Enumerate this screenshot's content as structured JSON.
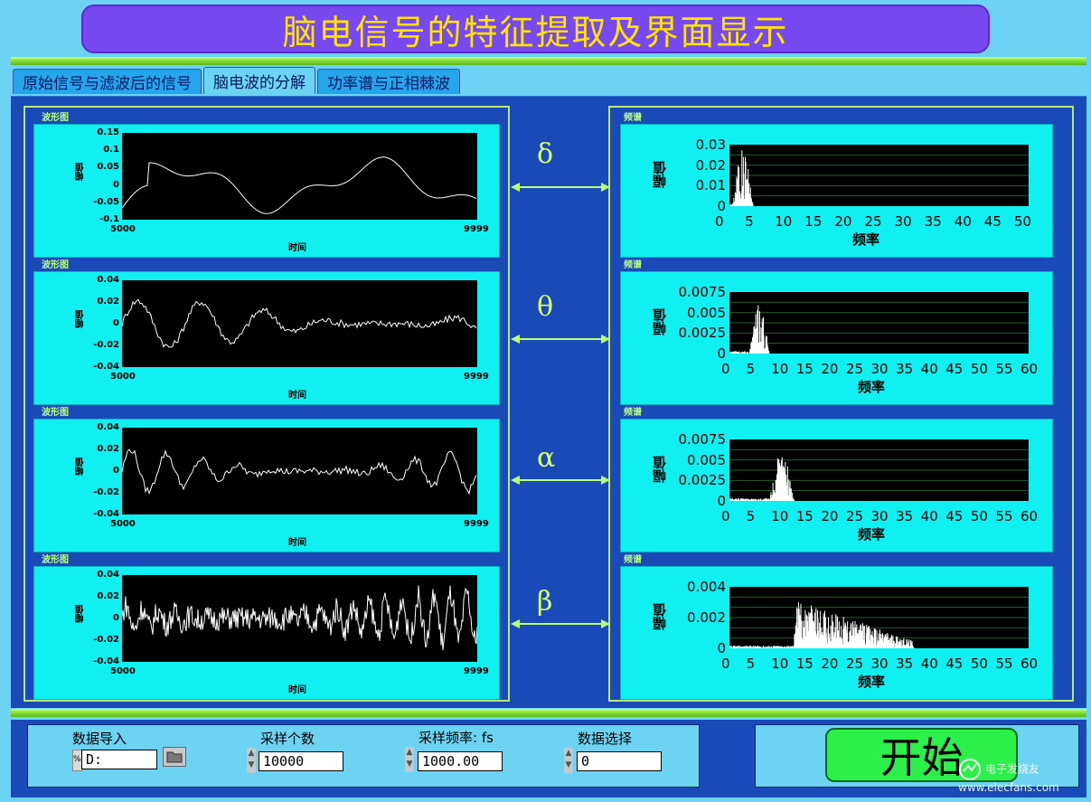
{
  "title": "脑电信号的特征提取及界面显示",
  "tabs": [
    {
      "label": "原始信号与滤波后的信号",
      "active": false
    },
    {
      "label": "脑电波的分解",
      "active": true
    },
    {
      "label": "功率谱与正相棘波",
      "active": false
    }
  ],
  "waveforms": [
    {
      "label": "波形图",
      "ylabel": "幅值",
      "xlabel": "时间",
      "yticks": [
        "0.15",
        "0.1",
        "0.05",
        "0",
        "-0.05",
        "-0.1"
      ],
      "xticks": [
        "5000",
        "9999"
      ]
    },
    {
      "label": "波形图",
      "ylabel": "幅值",
      "xlabel": "时间",
      "yticks": [
        "0.04",
        "0.02",
        "0",
        "-0.02",
        "-0.04"
      ],
      "xticks": [
        "5000",
        "9999"
      ]
    },
    {
      "label": "波形图",
      "ylabel": "幅值",
      "xlabel": "时间",
      "yticks": [
        "0.04",
        "0.02",
        "0",
        "-0.02",
        "-0.04"
      ],
      "xticks": [
        "5000",
        "9999"
      ]
    },
    {
      "label": "波形图",
      "ylabel": "幅值",
      "xlabel": "时间",
      "yticks": [
        "0.04",
        "0.02",
        "0",
        "-0.02",
        "-0.04"
      ],
      "xticks": [
        "5000",
        "9999"
      ]
    }
  ],
  "bands": [
    {
      "symbol": "δ"
    },
    {
      "symbol": "θ"
    },
    {
      "symbol": "α"
    },
    {
      "symbol": "β"
    }
  ],
  "spectra": [
    {
      "label": "频谱",
      "ylabel": "幅值",
      "xlabel": "频率",
      "yticks": [
        "0.03",
        "0.02",
        "0.01",
        "0"
      ],
      "xticks": [
        "0",
        "5",
        "10",
        "15",
        "20",
        "25",
        "30",
        "35",
        "40",
        "45",
        "50"
      ],
      "peak_band_hz": [
        0.5,
        4
      ]
    },
    {
      "label": "频谱",
      "ylabel": "幅值",
      "xlabel": "频率",
      "yticks": [
        "0.0075",
        "0.005",
        "0.0025",
        "0"
      ],
      "xticks": [
        "0",
        "5",
        "10",
        "15",
        "20",
        "25",
        "30",
        "35",
        "40",
        "45",
        "50",
        "55",
        "60"
      ],
      "peak_band_hz": [
        4,
        8
      ]
    },
    {
      "label": "频谱",
      "ylabel": "幅值",
      "xlabel": "频率",
      "yticks": [
        "0.0075",
        "0.005",
        "0.0025",
        "0"
      ],
      "xticks": [
        "0",
        "5",
        "10",
        "15",
        "20",
        "25",
        "30",
        "35",
        "40",
        "45",
        "50",
        "55",
        "60"
      ],
      "peak_band_hz": [
        8,
        13
      ]
    },
    {
      "label": "频谱",
      "ylabel": "幅值",
      "xlabel": "频率",
      "yticks": [
        "0.004",
        "0.002",
        "0"
      ],
      "xticks": [
        "0",
        "5",
        "10",
        "15",
        "20",
        "25",
        "30",
        "35",
        "40",
        "45",
        "50",
        "55",
        "60"
      ],
      "peak_band_hz": [
        13,
        37
      ]
    }
  ],
  "controls": {
    "data_import_label": "数据导入",
    "path_prefix": "%",
    "path_value": "D:",
    "sample_count_label": "采样个数",
    "sample_count_value": "10000",
    "fs_label": "采样频率: fs",
    "fs_value": "1000.00",
    "data_select_label": "数据选择",
    "data_select_value": "0",
    "start_label": "开始"
  },
  "watermark": "电子发烧友 www.elecfans.com",
  "colors": {
    "title_bg": "#7848f0",
    "title_text": "#ffe400",
    "panel": "#1a49b8",
    "plot_bg": "#10f0f0",
    "start_button": "#2cf04a"
  }
}
